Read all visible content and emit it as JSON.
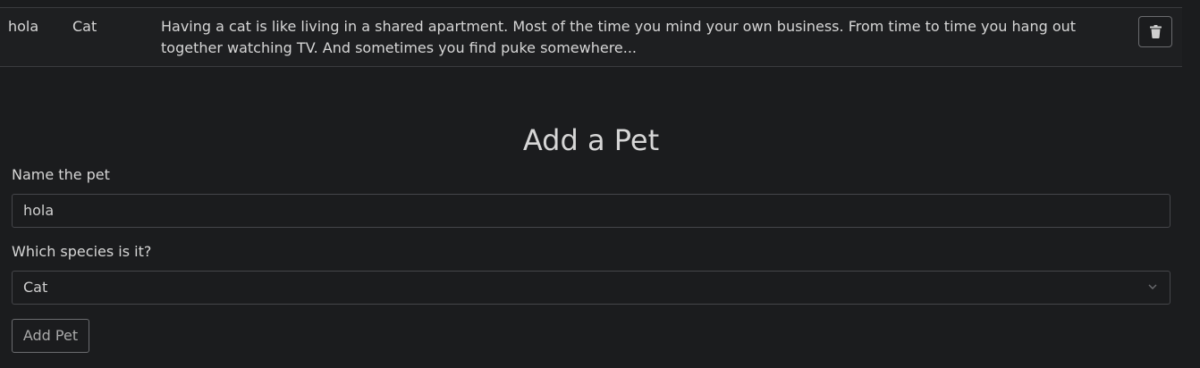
{
  "pets_table": {
    "rows": [
      {
        "name": "hola",
        "species": "Cat",
        "description": "Having a cat is like living in a shared apartment. Most of the time you mind your own business. From time to time you hang out together watching TV. And sometimes you find puke somewhere..."
      }
    ],
    "delete_icon": "trash-icon"
  },
  "form": {
    "title": "Add a Pet",
    "name_label": "Name the pet",
    "name_value": "hola",
    "species_label": "Which species is it?",
    "species_value": "Cat",
    "submit_label": "Add Pet"
  }
}
